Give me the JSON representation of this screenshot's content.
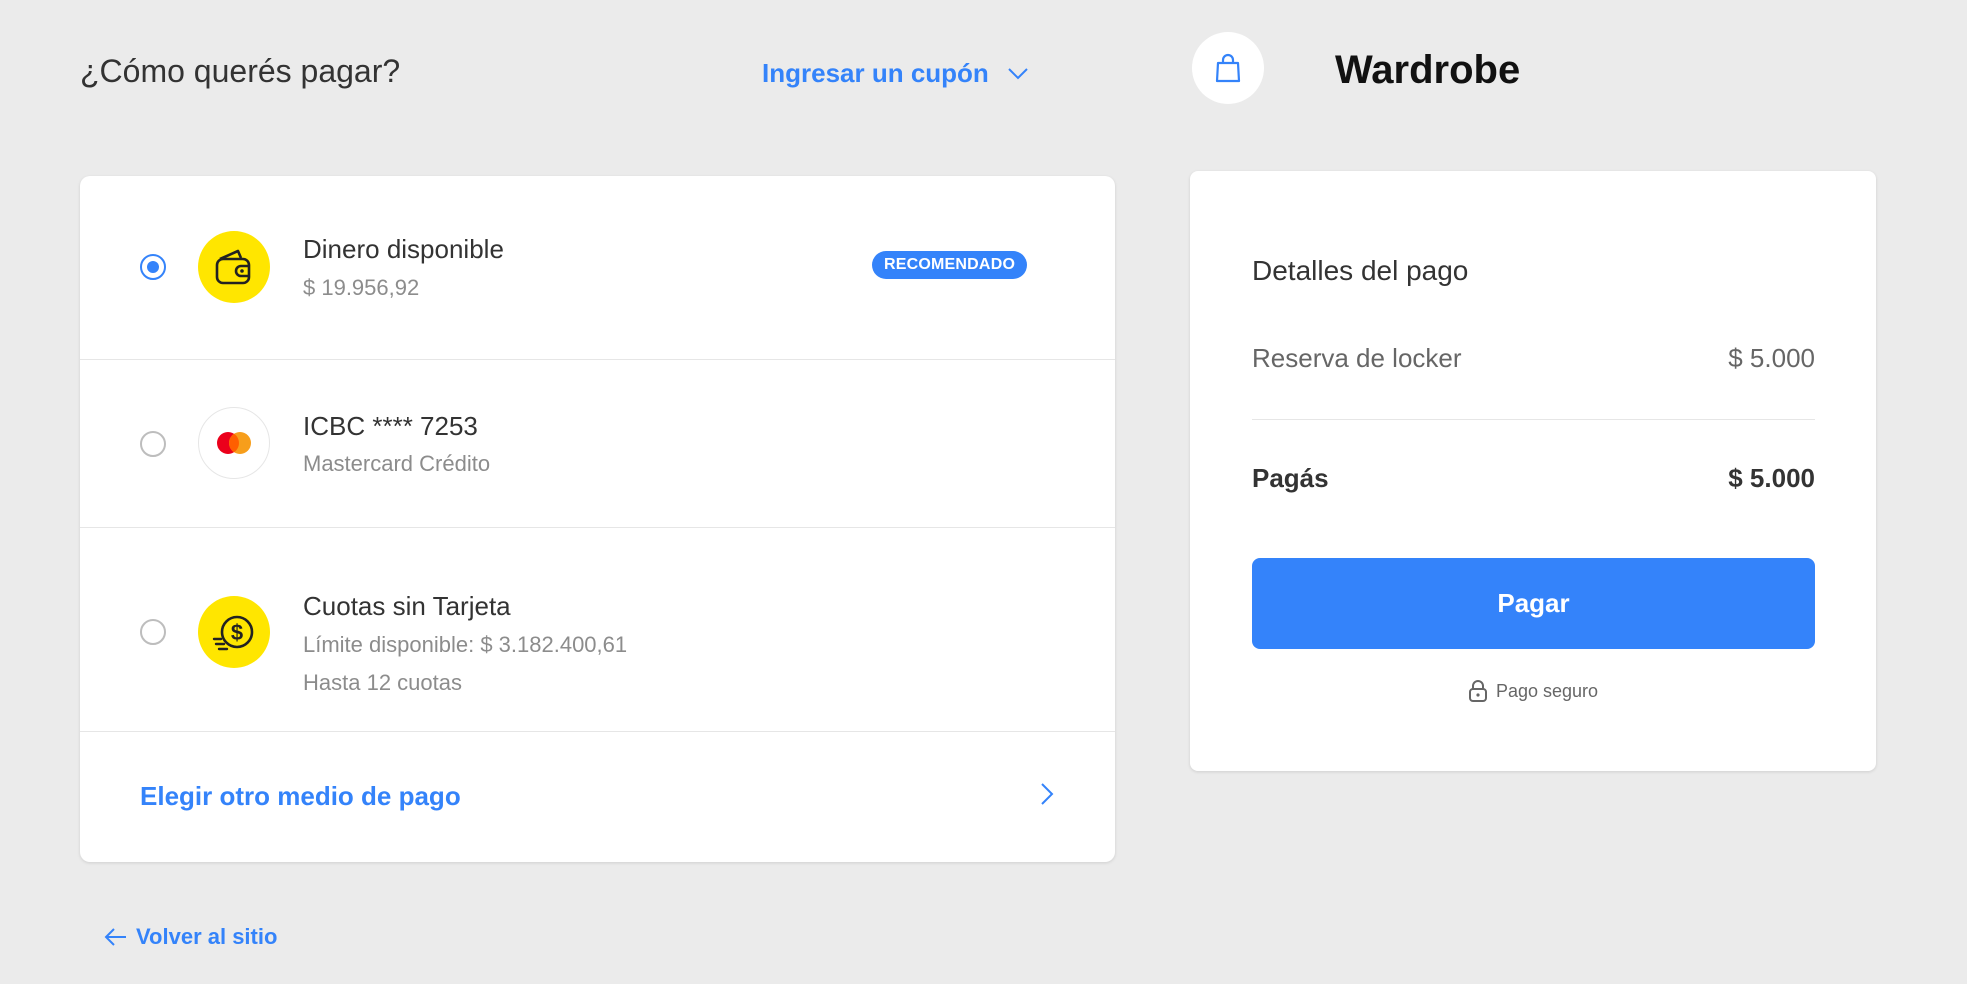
{
  "header": {
    "heading": "¿Cómo querés pagar?",
    "coupon_label": "Ingresar un cupón"
  },
  "store": {
    "name": "Wardrobe",
    "icon": "shopping-bag-icon"
  },
  "methods": [
    {
      "title": "Dinero disponible",
      "subtitle": "$ 19.956,92",
      "badge": "RECOMENDADO",
      "selected": true,
      "icon": "wallet-icon"
    },
    {
      "title": "ICBC **** 7253",
      "subtitle": "Mastercard Crédito",
      "selected": false,
      "icon": "mastercard-icon"
    },
    {
      "title": "Cuotas sin Tarjeta",
      "subtitle": "Límite disponible: $ 3.182.400,61",
      "subtitle2": "Hasta 12 cuotas",
      "selected": false,
      "icon": "dollar-coin-icon"
    }
  ],
  "other_method": "Elegir otro medio de pago",
  "back_link": "Volver al sitio",
  "summary": {
    "title": "Detalles del pago",
    "items": [
      {
        "label": "Reserva de locker",
        "value": "$ 5.000"
      }
    ],
    "total_label": "Pagás",
    "total_value": "$ 5.000",
    "pay_button": "Pagar",
    "secure_label": "Pago seguro"
  },
  "colors": {
    "accent": "#3483fa",
    "brand_yellow": "#ffe600",
    "background": "#ebebeb"
  }
}
